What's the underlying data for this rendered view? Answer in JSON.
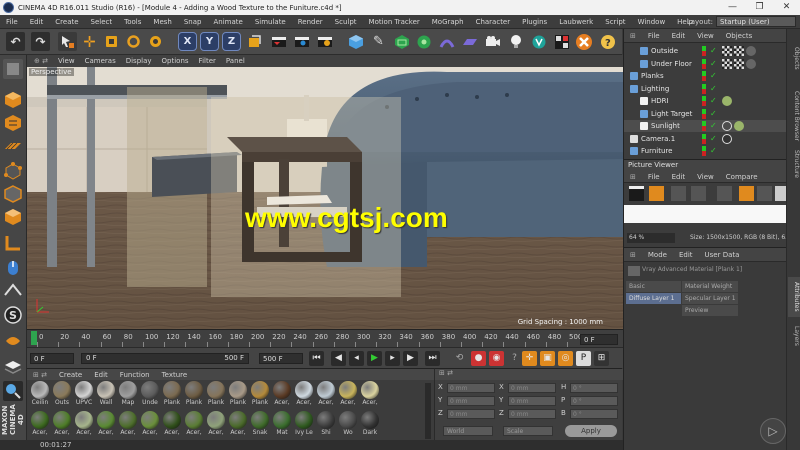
{
  "window": {
    "title": "CINEMA 4D R16.011 Studio (R16) - [Module 4 - Adding a Wood Texture to the Funiture.c4d *]",
    "minimize": "—",
    "restore": "❐",
    "close": "✕"
  },
  "menubar": {
    "items": [
      "File",
      "Edit",
      "Create",
      "Select",
      "Tools",
      "Mesh",
      "Snap",
      "Animate",
      "Simulate",
      "Render",
      "Sculpt",
      "Motion Tracker",
      "MoGraph",
      "Character",
      "Plugins",
      "Laubwerk",
      "Script",
      "Window",
      "Help"
    ],
    "layout_label": "Layout:",
    "layout_value": "Startup (User)"
  },
  "toolbar": {
    "axis_x": "X",
    "axis_y": "Y",
    "axis_z": "Z"
  },
  "viewport": {
    "menu": [
      "View",
      "Cameras",
      "Display",
      "Options",
      "Filter",
      "Panel"
    ],
    "label": "Perspective",
    "watermark": "www.cgtsj.com",
    "grid_spacing": "Grid Spacing : 1000 mm"
  },
  "timeline": {
    "ticks": [
      "0",
      "20",
      "40",
      "60",
      "80",
      "100",
      "120",
      "140",
      "160",
      "180",
      "200",
      "220",
      "240",
      "260",
      "280",
      "300",
      "320",
      "340",
      "360",
      "380",
      "400",
      "420",
      "440",
      "460",
      "480",
      "500"
    ],
    "current_frame": "0 F"
  },
  "playback": {
    "start_field": "0 F",
    "range_start": "0 F",
    "range_end": "500 F",
    "end_field": "500 F"
  },
  "materials": {
    "menu": [
      "Create",
      "Edit",
      "Function",
      "Texture"
    ],
    "row1": [
      {
        "label": "Ceilin",
        "color": "#b9b9b9"
      },
      {
        "label": "Outs",
        "color": "#8a7a5a"
      },
      {
        "label": "UPVC",
        "color": "#d4d4d4"
      },
      {
        "label": "Wall",
        "color": "#c8c2b5"
      },
      {
        "label": "Map",
        "color": "#9f9f9f"
      },
      {
        "label": "Unde",
        "color": "#5b5b5b"
      },
      {
        "label": "Plank",
        "color": "#7b6a50"
      },
      {
        "label": "Plank",
        "color": "#6d5c43"
      },
      {
        "label": "Plank",
        "color": "#85745a"
      },
      {
        "label": "Plank",
        "color": "#a89a88"
      },
      {
        "label": "Plank",
        "color": "#b48a3a"
      },
      {
        "label": "Acer,",
        "color": "#5a3a24"
      },
      {
        "label": "Acer,",
        "color": "#cfd9e0"
      },
      {
        "label": "Acer,",
        "color": "#bfcbd4"
      },
      {
        "label": "Acer,",
        "color": "#c8b45c"
      },
      {
        "label": "Acer,",
        "color": "#dad3a0"
      }
    ],
    "row2": [
      {
        "label": "Acer,",
        "color": "#3d6a1f"
      },
      {
        "label": "Acer,",
        "color": "#4e7d28"
      },
      {
        "label": "Acer,",
        "color": "#a6b58c"
      },
      {
        "label": "Acer,",
        "color": "#5a8a33"
      },
      {
        "label": "Acer,",
        "color": "#4d6e2b"
      },
      {
        "label": "Acer,",
        "color": "#6a8f3b"
      },
      {
        "label": "Acer,",
        "color": "#304f1a"
      },
      {
        "label": "Acer,",
        "color": "#5a7d34"
      },
      {
        "label": "Acer,",
        "color": "#8fa27a"
      },
      {
        "label": "Acer,",
        "color": "#4a6a2a"
      },
      {
        "label": "Snak",
        "color": "#3f6b2a"
      },
      {
        "label": "Mat",
        "color": "#3a6d2d"
      },
      {
        "label": "Ivy Le",
        "color": "#2f5a1f"
      },
      {
        "label": "Shi",
        "color": "#3c3c3c"
      },
      {
        "label": "Wo",
        "color": "#4a4a4a"
      },
      {
        "label": "Dark",
        "color": "#333333"
      }
    ]
  },
  "coords": {
    "rows": [
      {
        "axis": "X",
        "pos": "0 mm",
        "axis2": "X",
        "size": "0 mm",
        "rot_label": "H",
        "rot": "0 °"
      },
      {
        "axis": "Y",
        "pos": "0 mm",
        "axis2": "Y",
        "size": "0 mm",
        "rot_label": "P",
        "rot": "0 °"
      },
      {
        "axis": "Z",
        "pos": "0 mm",
        "axis2": "Z",
        "size": "0 mm",
        "rot_label": "B",
        "rot": "0 °"
      }
    ],
    "mode": "World",
    "scale": "Scale",
    "apply": "Apply"
  },
  "objects": {
    "menu": [
      "File",
      "Edit",
      "View",
      "Objects"
    ],
    "items": [
      {
        "name": "Outside",
        "depth": 1
      },
      {
        "name": "Under Floor",
        "depth": 1
      },
      {
        "name": "Planks",
        "depth": 0
      },
      {
        "name": "Lighting",
        "depth": 0
      },
      {
        "name": "HDRI",
        "depth": 1
      },
      {
        "name": "Light Target",
        "depth": 1
      },
      {
        "name": "Sunlight",
        "depth": 1
      },
      {
        "name": "Camera.1",
        "depth": 0
      },
      {
        "name": "Furniture",
        "depth": 0
      }
    ]
  },
  "picture_viewer": {
    "title": "Picture Viewer",
    "menu": [
      "File",
      "Edit",
      "View",
      "Compare"
    ],
    "zoom": "64 %",
    "size_info": "Size: 1500x1500, RGB (8 Bit), 6.44 M"
  },
  "attributes": {
    "menu": [
      "Mode",
      "Edit",
      "User Data"
    ],
    "material_title": "Vray Advanced Material [Plank 1]",
    "tabs": [
      "Basic",
      "Material Weight",
      "Diffuse Layer 1",
      "Specular Layer 1",
      "Preview"
    ]
  },
  "right_tabs": [
    "Objects",
    "Content Browser",
    "Structure",
    "Attributes",
    "Layers"
  ],
  "status": {
    "time": "00:01:27",
    "logo": "MAXON CINEMA 4D"
  }
}
